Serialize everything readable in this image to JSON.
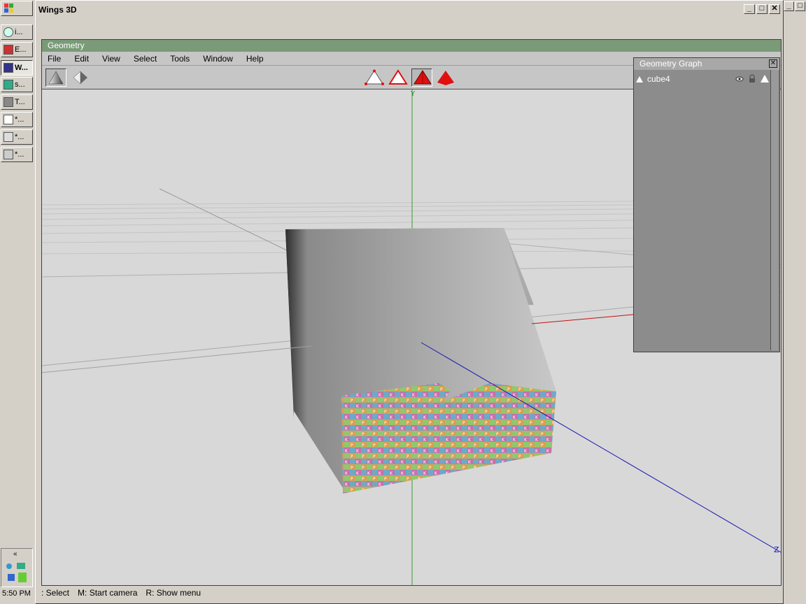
{
  "window": {
    "title": "Wings 3D"
  },
  "taskbar": {
    "items": [
      {
        "label": "i...",
        "icon": "cd-icon"
      },
      {
        "label": "E...",
        "icon": "app-icon"
      },
      {
        "label": "W...",
        "icon": "wings-icon",
        "active": true
      },
      {
        "label": "s...",
        "icon": "image-icon"
      },
      {
        "label": "T...",
        "icon": "tool-icon"
      },
      {
        "label": "*...",
        "icon": "document-icon"
      },
      {
        "label": "*...",
        "icon": "document-icon"
      },
      {
        "label": "*...",
        "icon": "document-icon"
      }
    ],
    "clock": "5:50 PM",
    "tray_arrow": "«"
  },
  "geometry": {
    "title": "Geometry",
    "menu": [
      "File",
      "Edit",
      "View",
      "Select",
      "Tools",
      "Window",
      "Help"
    ],
    "axis_labels": {
      "y": "Y",
      "z": "Z"
    }
  },
  "graph": {
    "title": "Geometry Graph",
    "close": "✕",
    "objects": [
      {
        "name": "cube4"
      }
    ]
  },
  "statusbar": {
    "left": ": Select",
    "middle": "M: Start camera",
    "right": "R: Show menu"
  },
  "colors": {
    "panel_title": "#7a9a78",
    "selection_red": "#e01010",
    "viewport_bg": "#d8d8d8"
  }
}
